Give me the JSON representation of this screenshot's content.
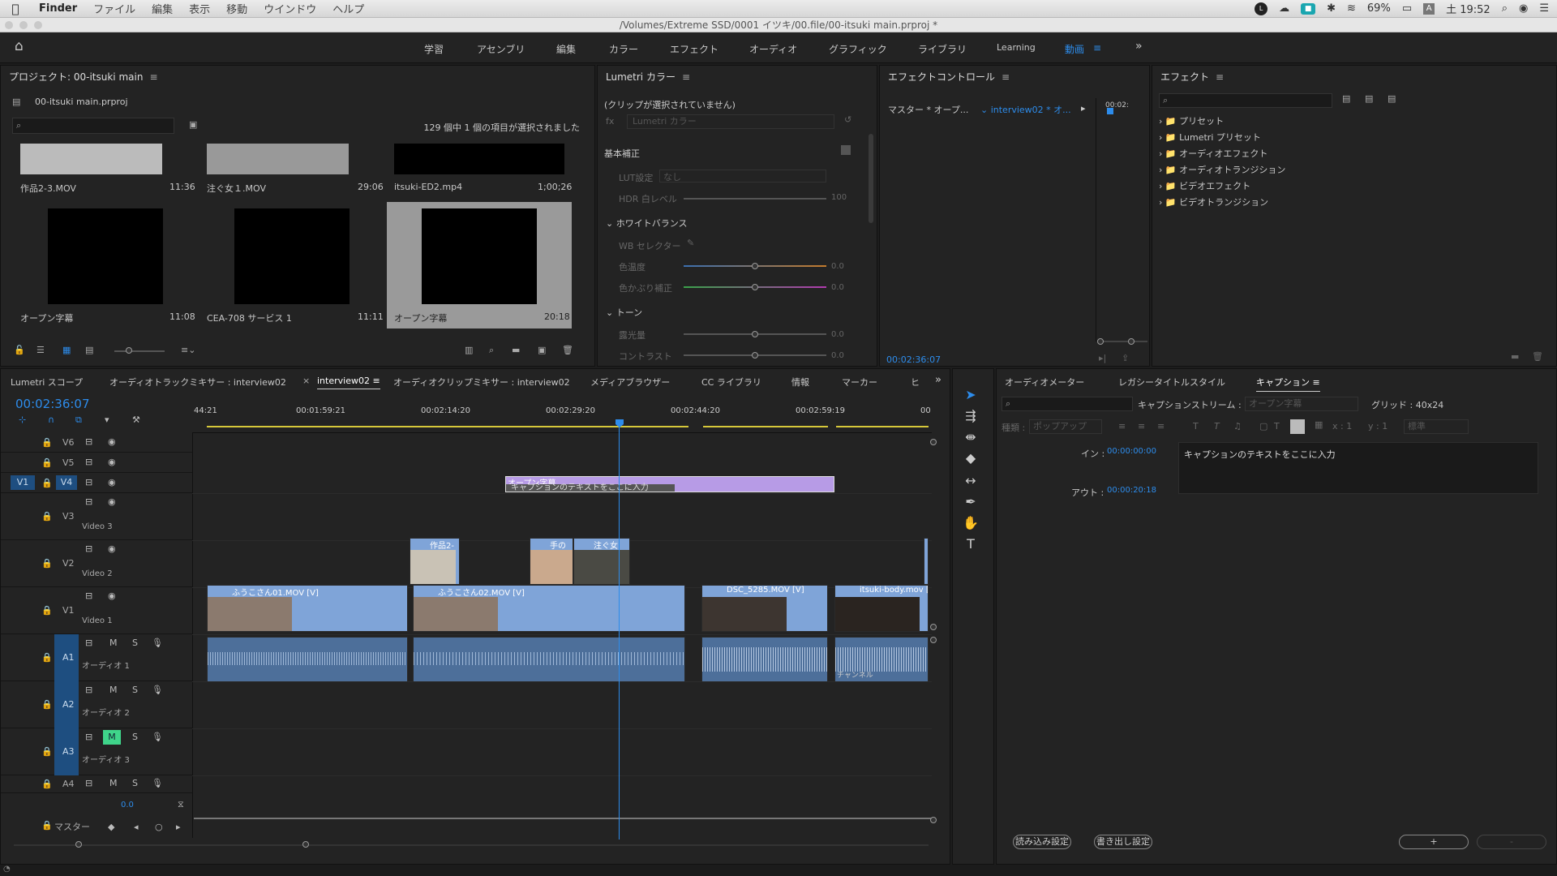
{
  "menubar": {
    "app": "Finder",
    "items": [
      "ファイル",
      "編集",
      "表示",
      "移動",
      "ウインドウ",
      "ヘルプ"
    ],
    "battery": "69%",
    "clock": "土 19:52"
  },
  "window": {
    "title": "/Volumes/Extreme SSD/0001 イツキ/00.file/00-itsuki main.prproj *"
  },
  "workspaces": [
    "学習",
    "アセンブリ",
    "編集",
    "カラー",
    "エフェクト",
    "オーディオ",
    "グラフィック",
    "ライブラリ",
    "Learning",
    "動画"
  ],
  "active_workspace": "動画",
  "project": {
    "title": "プロジェクト: 00-itsuki main",
    "file": "00-itsuki main.prproj",
    "selection": "129 個中 1 個の項目が選択されました",
    "items": [
      {
        "name": "作品2-3.MOV",
        "dur": "11:36"
      },
      {
        "name": "注ぐ女１.MOV",
        "dur": "29:06"
      },
      {
        "name": "itsuki-ED2.mp4",
        "dur": "1;00;26"
      },
      {
        "name": "オープン字幕",
        "dur": "11:08"
      },
      {
        "name": "CEA-708 サービス 1",
        "dur": "11:11"
      },
      {
        "name": "オープン字幕",
        "dur": "20:18"
      }
    ]
  },
  "lumetri": {
    "title": "Lumetri カラー",
    "noclip": "(クリップが選択されていません)",
    "fx_label": "Lumetri カラー",
    "basic": "基本補正",
    "lut_label": "LUT設定",
    "lut_value": "なし",
    "hdr_label": "HDR 白レベル",
    "hdr_value": "100",
    "wb": "ホワイトバランス",
    "wb_selector": "WB セレクター",
    "temp": "色温度",
    "temp_v": "0.0",
    "tint": "色かぶり補正",
    "tint_v": "0.0",
    "tone": "トーン",
    "exposure": "露光量",
    "exposure_v": "0.0",
    "contrast": "コントラスト",
    "contrast_v": "0.0"
  },
  "effect_controls": {
    "title": "エフェクトコントロール",
    "master": "マスター * オープ...",
    "seq": "interview02 * オ...",
    "tc_head": "00:02:",
    "timecode": "00:02:36:07"
  },
  "effects": {
    "title": "エフェクト",
    "items": [
      "プリセット",
      "Lumetri プリセット",
      "オーディオエフェクト",
      "オーディオトランジション",
      "ビデオエフェクト",
      "ビデオトランジション"
    ]
  },
  "timeline_tabs": [
    "Lumetri スコープ",
    "オーディオトラックミキサー : interview02",
    "interview02",
    "オーディオクリップミキサー : interview02",
    "メディアブラウザー",
    "CC ライブラリ",
    "情報",
    "マーカー",
    "ヒ"
  ],
  "timeline": {
    "timecode": "00:02:36:07",
    "ruler": [
      "44:21",
      "00:01:59:21",
      "00:02:14:20",
      "00:02:29:20",
      "00:02:44:20",
      "00:02:59:19",
      "00"
    ],
    "tracks": {
      "v6": "V6",
      "v5": "V5",
      "v4": "V4",
      "v1src": "V1",
      "v3": "V3",
      "v3name": "Video 3",
      "v2": "V2",
      "v2name": "Video 2",
      "v1": "V1",
      "v1name": "Video 1",
      "a1": "A1",
      "a1name": "オーディオ 1",
      "a2": "A2",
      "a2name": "オーディオ 2",
      "a3": "A3",
      "a3name": "オーディオ 3",
      "a4": "A4",
      "master": "マスター",
      "master_v": "0.0"
    },
    "clips": {
      "caption_title": "オープン字幕",
      "caption_text": "キャプションのテキストをここに入力",
      "v2a": "作品2-",
      "v2b": "手の",
      "v2c": "注ぐ女",
      "v1a": "ふうこさん01.MOV [V]",
      "v1b": "ふうこさん02.MOV [V]",
      "v1c": "DSC_5285.MOV [V]",
      "v1d": "itsuki-body.mov [V]",
      "a1d": "チャンネル"
    }
  },
  "right_tabs": [
    "オーディオメーター",
    "レガシータイトルスタイル",
    "キャプション"
  ],
  "captions": {
    "stream_label": "キャプションストリーム :",
    "stream_value": "オープン字幕",
    "grid": "グリッド : 40x24",
    "style_label": "種類 :",
    "style_value": "ポップアップ",
    "x": "x : 1",
    "y": "y : 1",
    "size": "標準",
    "in_label": "イン :",
    "in_tc": "00:00:00:00",
    "out_label": "アウト :",
    "out_tc": "00:00:20:18",
    "text": "キャプションのテキストをここに入力",
    "import": "読み込み設定",
    "export": "書き出し設定",
    "add": "+",
    "remove": "-"
  },
  "colors": {
    "accent": "#2d8ceb",
    "caption_clip": "#b79be6",
    "video_clip": "#7fa4d8",
    "audio_clip": "#4d6f9a",
    "playhead": "#2d8ceb",
    "mute_on": "#3fd48a"
  }
}
